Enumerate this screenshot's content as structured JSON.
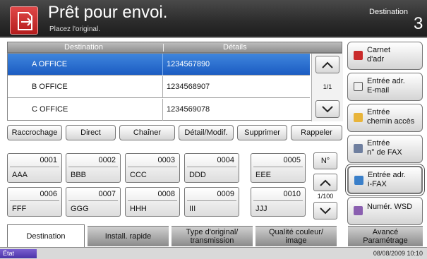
{
  "header": {
    "title": "Prêt pour envoi.",
    "subtitle": "Placez l'original.",
    "destination_label": "Destination",
    "destination_count": "3"
  },
  "list": {
    "col_destination": "Destination",
    "col_details": "Détails",
    "rows": [
      {
        "name": "A OFFICE",
        "detail": "1234567890"
      },
      {
        "name": "B OFFICE",
        "detail": "1234568907"
      },
      {
        "name": "C OFFICE",
        "detail": "1234569078"
      }
    ],
    "page": "1/1"
  },
  "actions": {
    "raccrochage": "Raccrochage",
    "direct": "Direct",
    "chainer": "Chaîner",
    "detail": "Détail/Modif.",
    "supprimer": "Supprimer",
    "rappeler": "Rappeler"
  },
  "keys": [
    {
      "num": "0001",
      "label": "AAA"
    },
    {
      "num": "0002",
      "label": "BBB"
    },
    {
      "num": "0003",
      "label": "CCC"
    },
    {
      "num": "0004",
      "label": "DDD"
    },
    {
      "num": "0005",
      "label": "EEE"
    },
    {
      "num": "0006",
      "label": "FFF"
    },
    {
      "num": "0007",
      "label": "GGG"
    },
    {
      "num": "0008",
      "label": "HHH"
    },
    {
      "num": "0009",
      "label": "III"
    },
    {
      "num": "0010",
      "label": "JJJ"
    }
  ],
  "keys_nav": {
    "no_label": "N°",
    "page": "1/100"
  },
  "right": {
    "carnet_1": "Carnet",
    "carnet_2": "d'adr",
    "email_1": "Entrée adr.",
    "email_2": "E-mail",
    "chemin_1": "Entrée",
    "chemin_2": "chemin accès",
    "fax_1": "Entrée",
    "fax_2": "n° de FAX",
    "ifax_1": "Entrée adr.",
    "ifax_2": "i-FAX",
    "wsd": "Numér. WSD"
  },
  "tabs": {
    "destination": "Destination",
    "install": "Install. rapide",
    "type_1": "Type d'original/",
    "type_2": "transmission",
    "qualite_1": "Qualité couleur/",
    "qualite_2": "image",
    "avance_1": "Avancé",
    "avance_2": "Paramétrage"
  },
  "status": {
    "label": "État",
    "datetime": "08/08/2009  10:10"
  },
  "icons": [
    "send-icon",
    "address-book-icon",
    "email-icon",
    "folder-icon",
    "fax-icon",
    "ifax-icon",
    "wsd-icon",
    "arrow-up-icon",
    "arrow-down-icon"
  ],
  "colors": {
    "selected_row": "#1c5cc2",
    "header_bg": "#2b2b2b",
    "status_badge": "#4b34a8"
  }
}
